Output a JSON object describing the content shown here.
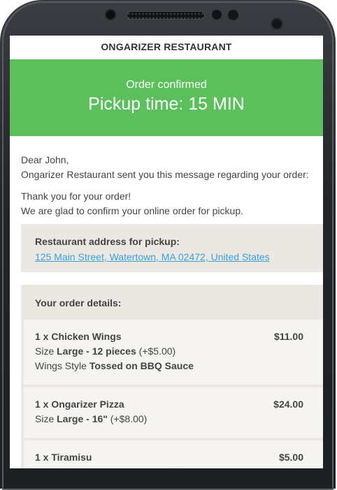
{
  "restaurant": {
    "name": "ONGARIZER RESTAURANT"
  },
  "banner": {
    "subtitle": "Order confirmed",
    "title": "Pickup time: 15 MIN",
    "color": "#5bbf5c"
  },
  "message": {
    "greeting": "Dear John,",
    "intro": "Ongarizer Restaurant sent you this message regarding your order:",
    "thanks": "Thank you for your order!",
    "confirm": "We are glad to confirm your online order for pickup."
  },
  "address": {
    "label": "Restaurant address for pickup:",
    "value": "125 Main Street, Watertown, MA 02472, United States",
    "link_color": "#3aa0d6"
  },
  "order": {
    "heading": "Your order details:",
    "items": [
      {
        "title": "1 x Chicken Wings",
        "price": "$11.00",
        "option1": {
          "name": "Size",
          "value": "Large - 12 pieces",
          "extra": "(+$5.00)"
        },
        "option2": {
          "name": "Wings Style",
          "value": "Tossed on BBQ Sauce"
        }
      },
      {
        "title": "1 x Ongarizer Pizza",
        "price": "$24.00",
        "option1": {
          "name": "Size",
          "value": "Large - 16\"",
          "extra": "(+$8.00)"
        }
      },
      {
        "title": "1 x Tiramisu",
        "price": "$5.00"
      }
    ]
  }
}
